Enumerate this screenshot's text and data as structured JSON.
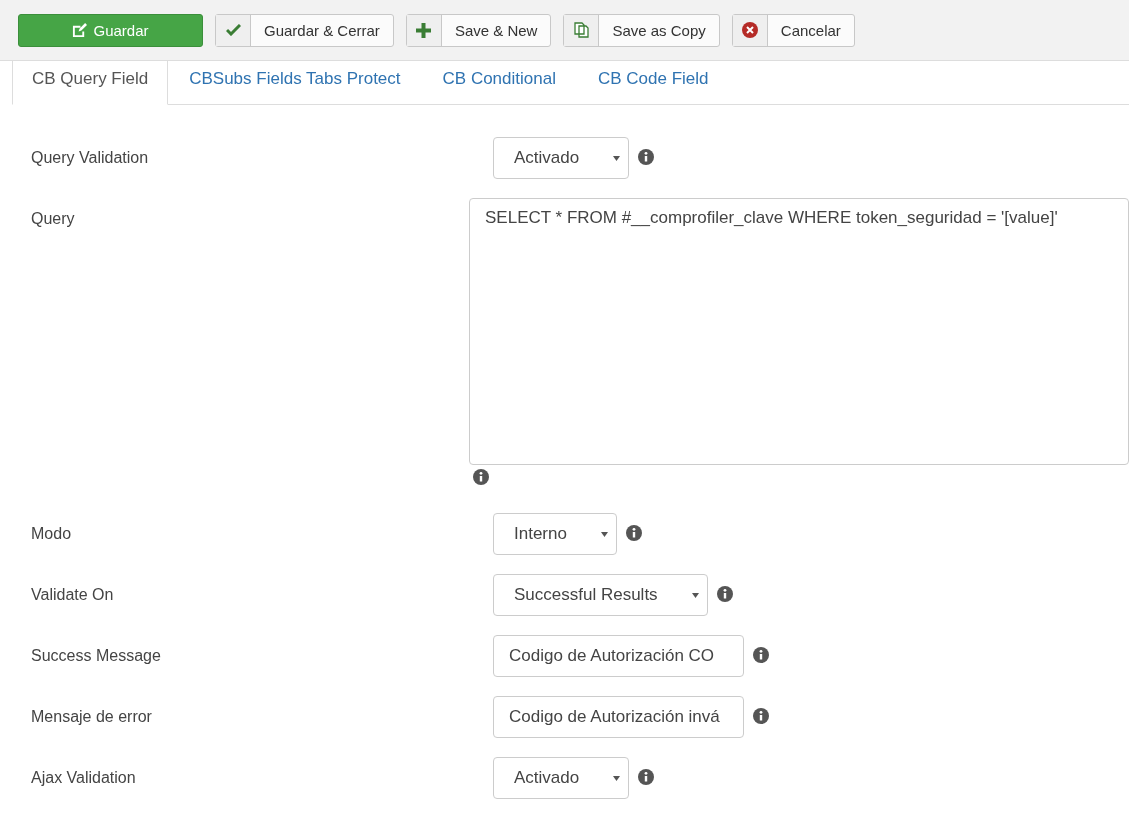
{
  "toolbar": [
    {
      "label": "Guardar",
      "kind": "save"
    },
    {
      "label": "Guardar & Cerrar",
      "kind": "check"
    },
    {
      "label": "Save & New",
      "kind": "plus"
    },
    {
      "label": "Save as Copy",
      "kind": "copy"
    },
    {
      "label": "Cancelar",
      "kind": "cancel"
    }
  ],
  "tabs": [
    {
      "label": "CB Query Field",
      "selected": true
    },
    {
      "label": "CBSubs Fields Tabs Protect",
      "selected": false
    },
    {
      "label": "CB Conditional",
      "selected": false
    },
    {
      "label": "CB Code Field",
      "selected": false
    }
  ],
  "fields": [
    {
      "label": "Query Validation",
      "kind": "select",
      "value": "Activado"
    },
    {
      "label": "Query",
      "kind": "textarea",
      "value": "SELECT * FROM #__comprofiler_clave WHERE token_seguridad = '[value]'"
    },
    {
      "label": "Modo",
      "kind": "select",
      "value": "Interno"
    },
    {
      "label": "Validate On",
      "kind": "select",
      "value": "Successful Results"
    },
    {
      "label": "Success Message",
      "kind": "text",
      "value": "Codigo de Autorización CO"
    },
    {
      "label": "Mensaje de error",
      "kind": "text",
      "value": "Codigo de Autorización invá"
    },
    {
      "label": "Ajax Validation",
      "kind": "select",
      "value": "Activado"
    }
  ]
}
